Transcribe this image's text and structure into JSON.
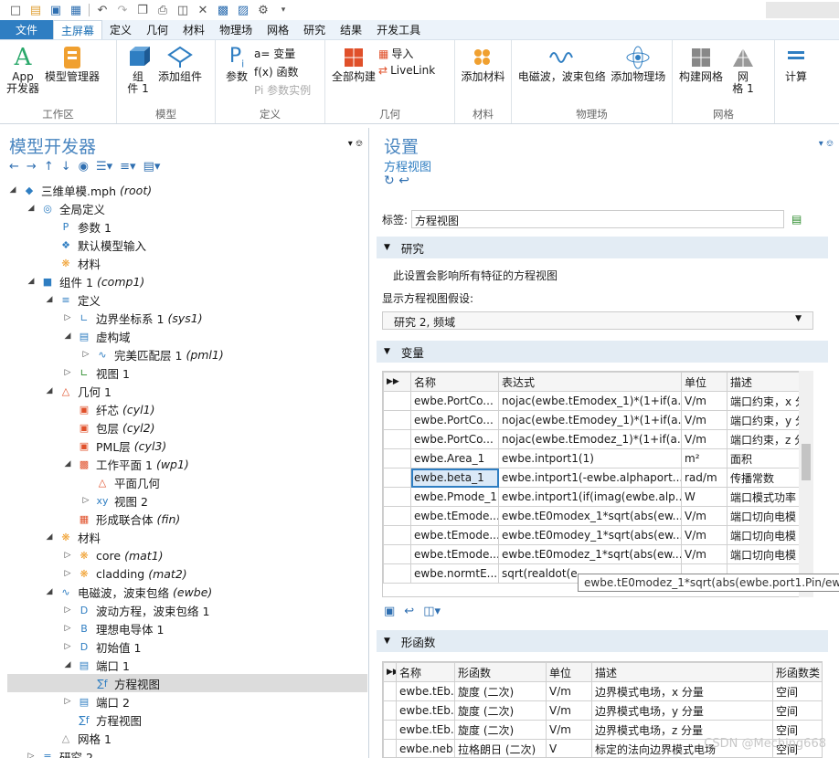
{
  "quick_access": {
    "icons": [
      "new-file-icon",
      "open-folder-icon",
      "save-icon",
      "save-as-icon",
      "undo-icon",
      "redo-icon",
      "copy-icon",
      "paste-icon",
      "duplicate-icon",
      "delete-icon",
      "select-icon",
      "deselect-icon",
      "settings-icon",
      "dropdown-icon"
    ]
  },
  "menubar": {
    "file": "文件",
    "tabs": [
      "主屏幕",
      "定义",
      "几何",
      "材料",
      "物理场",
      "网格",
      "研究",
      "结果",
      "开发工具"
    ],
    "active": "主屏幕"
  },
  "ribbon": {
    "app_label": "App\n开发器",
    "model_manager": "模型管理器",
    "workspace_group": "工作区",
    "component": "组\n件 1",
    "add_component": "添加组件",
    "model_group": "模型",
    "params": "参数",
    "variables": "a= 变量",
    "functions": "f(x) 函数",
    "param_cases": "Pi 参数实例",
    "def_group": "定义",
    "build_all": "全部构建",
    "import": "导入",
    "livelink": "LiveLink",
    "geom_group": "几何",
    "add_material": "添加材料",
    "mat_group": "材料",
    "ewbe": "电磁波，波束包络",
    "add_physics": "添加物理场",
    "phys_group": "物理场",
    "build_mesh": "构建网格",
    "mesh1": "网\n格 1",
    "mesh_group": "网格",
    "compute": "计算"
  },
  "left": {
    "title": "模型开发器",
    "tree": [
      {
        "d": 0,
        "arr": "◢",
        "icon": "root-icon",
        "t": "三维单模.mph",
        "tag": "(root)"
      },
      {
        "d": 1,
        "arr": "◢",
        "icon": "globe-icon",
        "t": "全局定义",
        "tag": ""
      },
      {
        "d": 2,
        "arr": "",
        "icon": "param-icon",
        "t": "参数 1",
        "tag": ""
      },
      {
        "d": 2,
        "arr": "",
        "icon": "model-input-icon",
        "t": "默认模型输入",
        "tag": ""
      },
      {
        "d": 2,
        "arr": "",
        "icon": "material-icon",
        "t": "材料",
        "tag": ""
      },
      {
        "d": 1,
        "arr": "◢",
        "icon": "component-icon",
        "t": "组件 1",
        "tag": "(comp1)"
      },
      {
        "d": 2,
        "arr": "◢",
        "icon": "definitions-icon",
        "t": "定义",
        "tag": ""
      },
      {
        "d": 3,
        "arr": "▷",
        "icon": "coord-icon",
        "t": "边界坐标系 1",
        "tag": "(sys1)"
      },
      {
        "d": 3,
        "arr": "◢",
        "icon": "virtual-domain-icon",
        "t": "虚构域",
        "tag": ""
      },
      {
        "d": 4,
        "arr": "▷",
        "icon": "pml-icon",
        "t": "完美匹配层 1",
        "tag": "(pml1)"
      },
      {
        "d": 3,
        "arr": "▷",
        "icon": "view-icon",
        "t": "视图 1",
        "tag": ""
      },
      {
        "d": 2,
        "arr": "◢",
        "icon": "geometry-icon",
        "t": "几何 1",
        "tag": ""
      },
      {
        "d": 3,
        "arr": "",
        "icon": "cylinder-icon",
        "t": "纤芯",
        "tag": "(cyl1)"
      },
      {
        "d": 3,
        "arr": "",
        "icon": "cylinder-icon",
        "t": "包层",
        "tag": "(cyl2)"
      },
      {
        "d": 3,
        "arr": "",
        "icon": "cylinder-icon",
        "t": "PML层",
        "tag": "(cyl3)"
      },
      {
        "d": 3,
        "arr": "◢",
        "icon": "workplane-icon",
        "t": "工作平面 1",
        "tag": "(wp1)"
      },
      {
        "d": 4,
        "arr": "",
        "icon": "plane-geometry-icon",
        "t": "平面几何",
        "tag": ""
      },
      {
        "d": 4,
        "arr": "▷",
        "icon": "view-2d-icon",
        "t": "视图 2",
        "tag": ""
      },
      {
        "d": 3,
        "arr": "",
        "icon": "union-icon",
        "t": "形成联合体",
        "tag": "(fin)"
      },
      {
        "d": 2,
        "arr": "◢",
        "icon": "materials-icon",
        "t": "材料",
        "tag": ""
      },
      {
        "d": 3,
        "arr": "▷",
        "icon": "material-icon",
        "t": "core",
        "tag": "(mat1)"
      },
      {
        "d": 3,
        "arr": "▷",
        "icon": "material-icon",
        "t": "cladding",
        "tag": "(mat2)"
      },
      {
        "d": 2,
        "arr": "◢",
        "icon": "ewbe-icon",
        "t": "电磁波，波束包络",
        "tag": "(ewbe)"
      },
      {
        "d": 3,
        "arr": "▷",
        "icon": "domain-node-icon",
        "t": "波动方程，波束包络 1",
        "tag": ""
      },
      {
        "d": 3,
        "arr": "▷",
        "icon": "boundary-node-icon",
        "t": "理想电导体 1",
        "tag": ""
      },
      {
        "d": 3,
        "arr": "▷",
        "icon": "domain-node-icon",
        "t": "初始值 1",
        "tag": ""
      },
      {
        "d": 3,
        "arr": "◢",
        "icon": "port-icon",
        "t": "端口 1",
        "tag": ""
      },
      {
        "d": 4,
        "arr": "",
        "icon": "equation-view-icon",
        "t": "方程视图",
        "tag": "",
        "sel": true
      },
      {
        "d": 3,
        "arr": "▷",
        "icon": "port-icon",
        "t": "端口 2",
        "tag": ""
      },
      {
        "d": 3,
        "arr": "",
        "icon": "equation-view-icon",
        "t": "方程视图",
        "tag": ""
      },
      {
        "d": 2,
        "arr": "",
        "icon": "mesh-icon",
        "t": "网格 1",
        "tag": ""
      },
      {
        "d": 1,
        "arr": "▷",
        "icon": "study-icon",
        "t": "研究 2",
        "tag": ""
      }
    ]
  },
  "right": {
    "title": "设置",
    "subtitle": "方程视图",
    "label_text": "标签:",
    "label_value": "方程视图",
    "study_section": "研究",
    "study_desc": "此设置会影响所有特征的方程视图",
    "study_field": "显示方程视图假设:",
    "study_value": "研究 2, 频域",
    "var_section": "变量",
    "var_headers": [
      "名称",
      "表达式",
      "单位",
      "描述"
    ],
    "var_rows": [
      [
        "ewbe.PortCo...",
        "nojac(ewbe.tEmodex_1)*(1+if(a...",
        "V/m",
        "端口约束，x 分"
      ],
      [
        "ewbe.PortCo...",
        "nojac(ewbe.tEmodey_1)*(1+if(a...",
        "V/m",
        "端口约束，y 分"
      ],
      [
        "ewbe.PortCo...",
        "nojac(ewbe.tEmodez_1)*(1+if(a...",
        "V/m",
        "端口约束，z 分"
      ],
      [
        "ewbe.Area_1",
        "ewbe.intport1(1)",
        "m²",
        "面积"
      ],
      [
        "ewbe.beta_1",
        "ewbe.intport1(-ewbe.alphaport...",
        "rad/m",
        "传播常数"
      ],
      [
        "ewbe.Pmode_1",
        "ewbe.intport1(if(imag(ewbe.alp...",
        "W",
        "端口模式功率"
      ],
      [
        "ewbe.tEmode...",
        "ewbe.tE0modex_1*sqrt(abs(ew...",
        "V/m",
        "端口切向电模"
      ],
      [
        "ewbe.tEmode...",
        "ewbe.tE0modey_1*sqrt(abs(ew...",
        "V/m",
        "端口切向电模"
      ],
      [
        "ewbe.tEmode...",
        "ewbe.tE0modez_1*sqrt(abs(ew...",
        "V/m",
        "端口切向电模"
      ],
      [
        "ewbe.normtE...",
        "sqrt(realdot(e...",
        "",
        ""
      ]
    ],
    "tooltip": "ewbe.tE0modez_1*sqrt(abs(ewbe.port1.Pin/ewbe",
    "shape_section": "形函数",
    "shape_headers": [
      "名称",
      "形函数",
      "单位",
      "描述",
      "形函数类"
    ],
    "shape_rows": [
      [
        "ewbe.tEb...",
        "旋度 (二次)",
        "V/m",
        "边界模式电场，x 分量",
        "空间"
      ],
      [
        "ewbe.tEb...",
        "旋度 (二次)",
        "V/m",
        "边界模式电场，y 分量",
        "空间"
      ],
      [
        "ewbe.tEb...",
        "旋度 (二次)",
        "V/m",
        "边界模式电场，z 分量",
        "空间"
      ],
      [
        "ewbe.neb...",
        "拉格朗日 (二次)",
        "V",
        "标定的法向边界模式电场",
        "空间"
      ]
    ],
    "watermark": "CSDN @Meching668"
  }
}
